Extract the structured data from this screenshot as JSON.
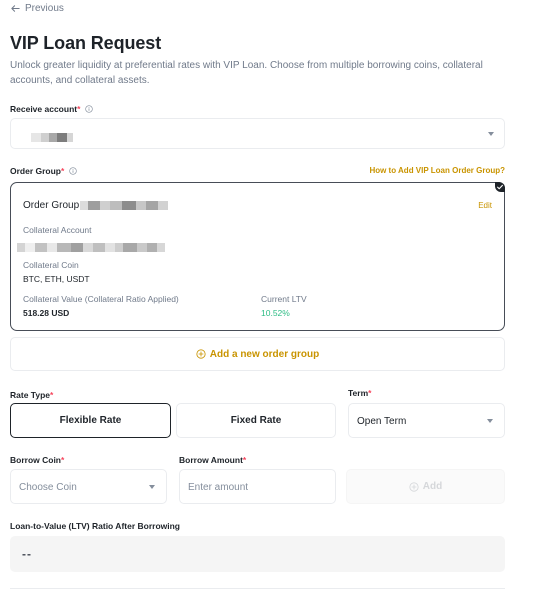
{
  "nav": {
    "back_label": "Previous"
  },
  "header": {
    "title": "VIP Loan Request",
    "description": "Unlock greater liquidity at preferential rates with VIP Loan. Choose from multiple borrowing coins, collateral accounts, and collateral assets."
  },
  "receive_account": {
    "label": "Receive account",
    "required_mark": "*"
  },
  "order_group": {
    "label": "Order Group",
    "required_mark": "*",
    "help_link": "How to Add VIP Loan Order Group?",
    "card": {
      "title": "Order Group",
      "edit_label": "Edit",
      "collateral_account_label": "Collateral Account",
      "collateral_coin_label": "Collateral Coin",
      "collateral_coin_value": "BTC, ETH, USDT",
      "collateral_value_label": "Collateral Value (Collateral Ratio Applied)",
      "collateral_value": "518.28 USD",
      "current_ltv_label": "Current LTV",
      "current_ltv_value": "10.52%"
    },
    "add_label": "Add a new order group"
  },
  "rate_type": {
    "label": "Rate Type",
    "required_mark": "*",
    "options": [
      "Flexible Rate",
      "Fixed Rate"
    ],
    "selected": "Flexible Rate"
  },
  "term": {
    "label": "Term",
    "required_mark": "*",
    "value": "Open Term"
  },
  "borrow_coin": {
    "label": "Borrow Coin",
    "required_mark": "*",
    "placeholder": "Choose Coin"
  },
  "borrow_amount": {
    "label": "Borrow Amount",
    "required_mark": "*",
    "placeholder": "Enter amount"
  },
  "add_button": {
    "label": "Add"
  },
  "ltv_after": {
    "label": "Loan-to-Value (LTV) Ratio After Borrowing",
    "value": "--"
  },
  "colors": {
    "accent": "#c99400",
    "required": "#f6465d",
    "positive": "#2ebd85",
    "text_primary": "#1e2329",
    "text_secondary": "#707a8a",
    "border": "#eaecef"
  },
  "icons": {
    "back": "arrow-left-icon",
    "info": "info-circle-icon",
    "dropdown": "caret-down-icon",
    "add": "plus-circle-icon",
    "selected": "check-icon"
  }
}
